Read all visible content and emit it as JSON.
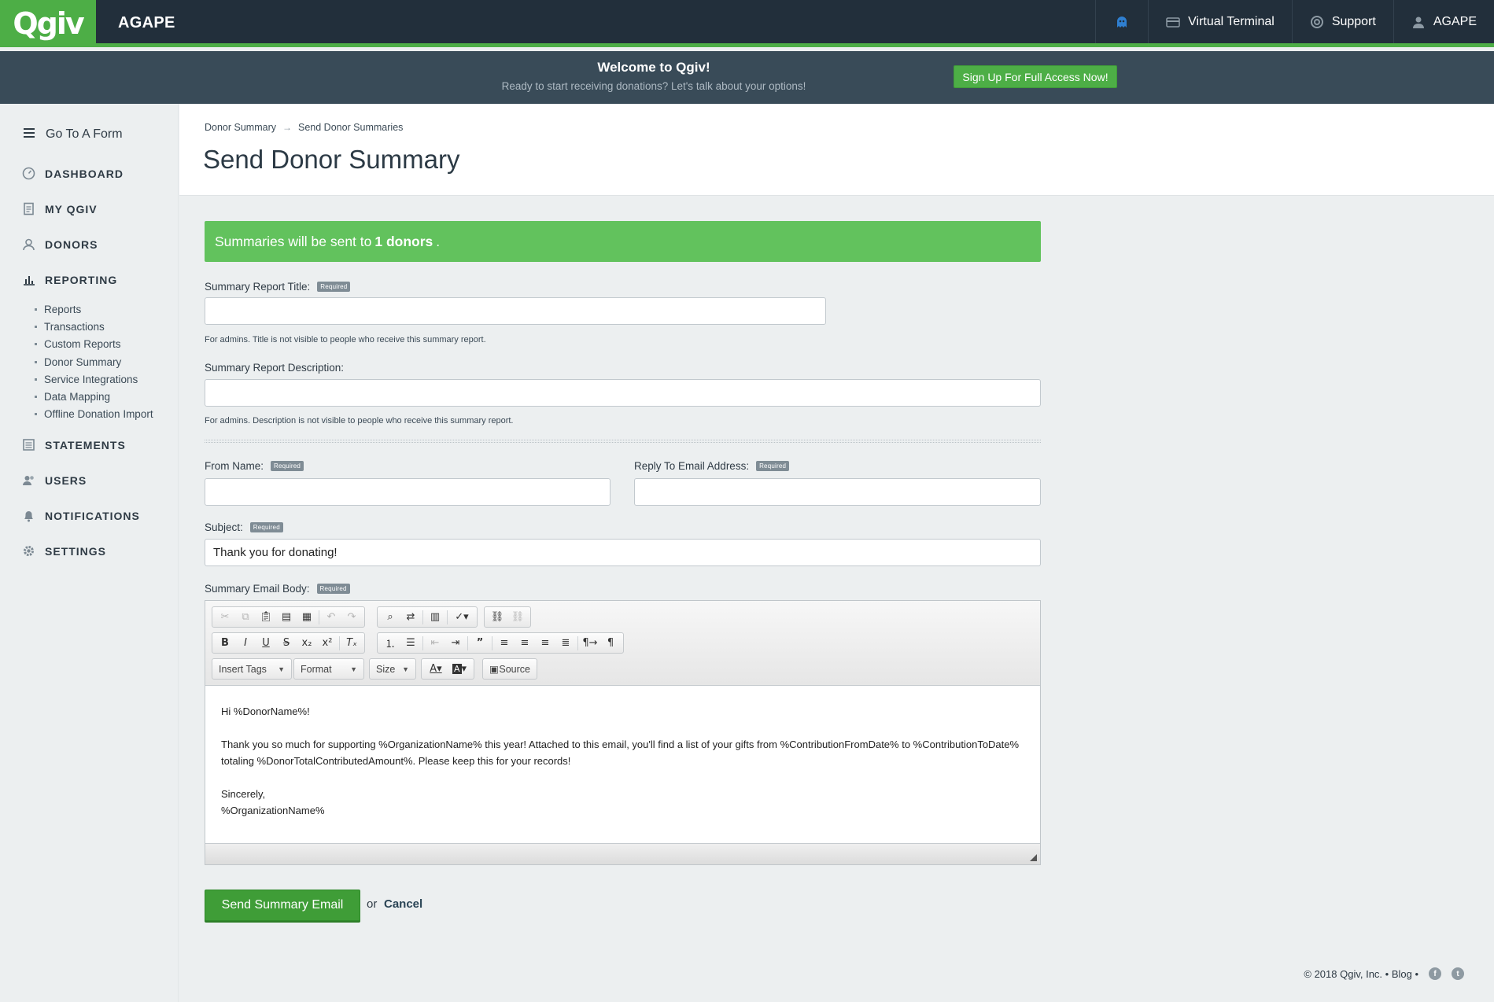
{
  "app": {
    "logo": "Qgiv",
    "org_name": "AGAPE"
  },
  "topnav": {
    "virtual_terminal": "Virtual Terminal",
    "support": "Support",
    "account": "AGAPE"
  },
  "banner": {
    "title": "Welcome to Qgiv!",
    "subtitle": "Ready to start receiving donations? Let's talk about your options!",
    "cta": "Sign Up For Full Access Now!"
  },
  "sidebar": {
    "goto": "Go To A Form",
    "items": [
      {
        "label": "DASHBOARD",
        "icon": "dashboard-icon"
      },
      {
        "label": "MY QGIV",
        "icon": "document-icon"
      },
      {
        "label": "DONORS",
        "icon": "donors-icon"
      },
      {
        "label": "REPORTING",
        "icon": "bar-chart-icon"
      },
      {
        "label": "STATEMENTS",
        "icon": "statements-icon"
      },
      {
        "label": "USERS",
        "icon": "users-icon"
      },
      {
        "label": "NOTIFICATIONS",
        "icon": "bell-icon"
      },
      {
        "label": "SETTINGS",
        "icon": "gear-icon"
      }
    ],
    "reporting_sub": [
      "Reports",
      "Transactions",
      "Custom Reports",
      "Donor Summary",
      "Service Integrations",
      "Data Mapping",
      "Offline Donation Import"
    ]
  },
  "breadcrumb": {
    "parent": "Donor Summary",
    "current": "Send Donor Summaries"
  },
  "page_title": "Send Donor Summary",
  "alert": {
    "prefix": "Summaries will be sent to",
    "count": "1 donors",
    "suffix": "."
  },
  "form": {
    "required_tag": "Required",
    "title_label": "Summary Report Title:",
    "title_value": "",
    "title_hint": "For admins. Title is not visible to people who receive this summary report.",
    "desc_label": "Summary Report Description:",
    "desc_value": "",
    "desc_hint": "For admins. Description is not visible to people who receive this summary report.",
    "from_label": "From Name:",
    "from_value": "",
    "reply_label": "Reply To Email Address:",
    "reply_value": "",
    "subject_label": "Subject:",
    "subject_value": "Thank you for donating!",
    "body_label": "Summary Email Body:"
  },
  "editor": {
    "combos": {
      "insert_tags": "Insert Tags",
      "format": "Format",
      "size": "Size",
      "source": "Source"
    },
    "body": {
      "greeting": "Hi %DonorName%!",
      "line1": "Thank you so much for supporting %OrganizationName% this year! Attached to this email, you'll find a list of your gifts from %ContributionFromDate% to %ContributionToDate%",
      "line2": "totaling %DonorTotalContributedAmount%. Please keep this for your records!",
      "closing": "Sincerely,",
      "signature": "%OrganizationName%"
    }
  },
  "actions": {
    "send": "Send Summary Email",
    "or": "or",
    "cancel": "Cancel"
  },
  "footer": {
    "copyright": "© 2018 Qgiv, Inc. • Blog •"
  },
  "colors": {
    "brand_green": "#4dae46",
    "nav_dark": "#222f3b",
    "banner": "#394b58",
    "alert_green": "#62c25d"
  }
}
